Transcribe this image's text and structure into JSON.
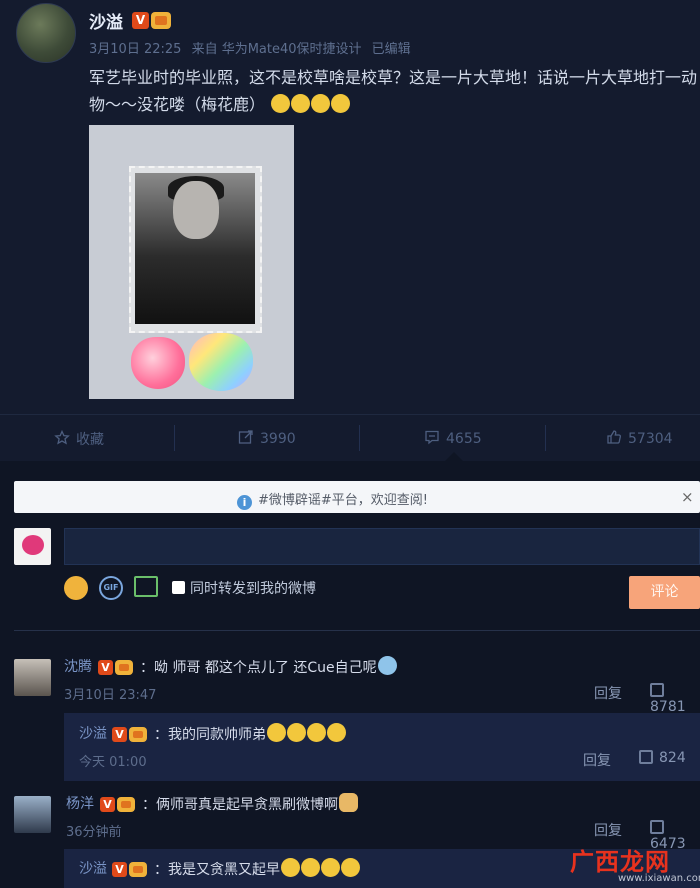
{
  "post": {
    "author": "沙溢",
    "meta": {
      "time": "3月10日 22:25",
      "source": "来自 华为Mate40保时捷设计",
      "edited": "已编辑"
    },
    "text": "军艺毕业时的毕业照，这不是校草啥是校草？这是一片大草地！话说一片大草地打一动物～～没花喽（梅花鹿）"
  },
  "actions": {
    "favorite": "收藏",
    "repost": "3990",
    "comment": "4655",
    "like": "57304"
  },
  "notice": {
    "text": "#微博辟谣#平台，欢迎查阅!",
    "close": "×"
  },
  "composer": {
    "tool_gif": "GIF",
    "repost_checkbox_label": "同时转发到我的微博",
    "submit": "评论"
  },
  "comments": [
    {
      "name": "沈腾",
      "text": "：呦 师哥 都这个点儿了 还Cue自己呢",
      "time": "3月10日 23:47",
      "reply": "回复",
      "likes": "8781",
      "sub": {
        "name": "沙溢",
        "text": "：我的同款帅师弟",
        "time": "今天 01:00",
        "reply": "回复",
        "likes": "824"
      }
    },
    {
      "name": "杨洋",
      "text": "：俩师哥真是起早贪黑刷微博啊",
      "time": "36分钟前",
      "reply": "回复",
      "likes": "6473",
      "sub": {
        "name": "沙溢",
        "text": "：我是又贪黑又起早"
      }
    }
  ],
  "watermark": {
    "brand": "广西龙网",
    "sub": "www.ixiawan.com"
  },
  "colors": {
    "background": "#141b2e",
    "comment_background": "#0f1524",
    "link_name": "#7a95c7",
    "submit_button": "#f7a47a",
    "verified_badge": "#e04a1a"
  },
  "icons": [
    "star-icon",
    "repost-icon",
    "comment-icon",
    "thumb-up-icon",
    "info-icon",
    "smile-icon",
    "gif-icon",
    "image-icon"
  ]
}
